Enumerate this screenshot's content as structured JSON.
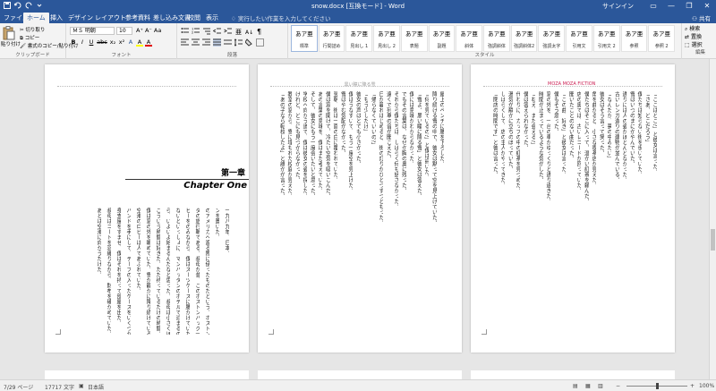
{
  "titlebar": {
    "title": "snow.docx [互換モード] - Word",
    "signin": "サインイン"
  },
  "tabs": [
    {
      "label": "ファイル"
    },
    {
      "label": "ホーム"
    },
    {
      "label": "挿入"
    },
    {
      "label": "デザイン"
    },
    {
      "label": "レイアウト"
    },
    {
      "label": "参考資料"
    },
    {
      "label": "差し込み文書"
    },
    {
      "label": "校閲"
    },
    {
      "label": "表示"
    }
  ],
  "tell_me": "実行したい作業を入力してください",
  "share": "共有",
  "ribbon": {
    "clipboard": {
      "paste": "貼り付け",
      "cut": "切り取り",
      "copy": "コピー",
      "format_painter": "書式のコピー/貼り付け",
      "group": "クリップボード"
    },
    "font": {
      "name": "ＭＳ 明朝",
      "size": "10",
      "buttons": [
        "B",
        "I",
        "U",
        "abc",
        "x₂",
        "x²",
        "A",
        "A",
        "A"
      ],
      "group": "フォント"
    },
    "paragraph": {
      "group": "段落"
    },
    "styles": {
      "group": "スタイル",
      "items": [
        {
          "sample": "あア亜",
          "name": "標準"
        },
        {
          "sample": "あア亜",
          "name": "行間詰め"
        },
        {
          "sample": "あア亜",
          "name": "見出し 1"
        },
        {
          "sample": "あア亜",
          "name": "見出し 2"
        },
        {
          "sample": "あア亜",
          "name": "表題"
        },
        {
          "sample": "あア亜",
          "name": "副題"
        },
        {
          "sample": "あア亜",
          "name": "斜体"
        },
        {
          "sample": "あア亜",
          "name": "強調斜体"
        },
        {
          "sample": "あア亜",
          "name": "強調斜体2"
        },
        {
          "sample": "あア亜",
          "name": "強調太字"
        },
        {
          "sample": "あア亜",
          "name": "引用文"
        },
        {
          "sample": "あア亜",
          "name": "引用文 2"
        },
        {
          "sample": "あア亜",
          "name": "参照"
        },
        {
          "sample": "あア亜",
          "name": "参照 2"
        }
      ]
    },
    "editing": {
      "group": "編集",
      "find": "検索",
      "replace": "置換",
      "select": "選択"
    }
  },
  "pages": {
    "p2_header": "黒い瞳に降る雪",
    "p3_header": "MOZA MOZA FICTION",
    "chapter_jp": "第一章",
    "chapter_en": "Chapter One",
    "p1_columns": [
      "一九八九年、日本。",
      "ンを置いた。",
      "のアメリカへ渡る際に使ったものだという。ボストンバッグの中にはパス",
      "ダの旅行鞄である。叔母が昔、このボストンバッグ一つで",
      "ヒーをのみながら、僕はスーツケースに腰かけていた。",
      "ないといっしょに、マンハッタンのホテルで泊まるのだ。",
      "ら、いよいよ始まるんだなと思った。叔母は小さくほほえんだ。",
      "こういう時間は好きだ。ただ待っているだけの時間。",
      "僕は窓の外を眺めていた。雪が静かに降り続けている。",
      "空港のロビーは人であふれていた。",
      "バンドを手にして、テープの入ったケースをいくつか",
      "身支度をすませ、僕はそれを持って部屋を出た。",
      "叔母はコートを羽織りながら、財布を確かめていた。",
      "あとは空港に向かうだけだ。"
    ],
    "p2_columns": [
      "屋上のベンチに腰を下ろした。",
      "降り続ける雪の中で、彼女は黙って空を見上げていた。",
      "「何を見ているの?」と僕は訊いた。",
      "「雪よ。黒い瞳に降る雪」と彼女は答えた。",
      "僕には意味がわからなかった。",
      "でもその言葉は、なぜか胸の奥に残った。",
      "それから僕たちは、しばらく何も話さなかった。",
      "遠くで列車の音が聞こえた。",
      "日が暮れはじめると、街の灯りがひとつずつともった。",
      "「帰らなくていいの?」",
      "「もう少しだけ」",
      "彼女の声はとても小さかった。",
      "僕はうなずいて、もう一度空を見上げた。",
      "雪はやむ気配がなかった。",
      "翌朝、街は一面の白に覆われていた。",
      "僕は窓を開けて、冷たい空気を吸いこんだ。",
      "あの言葉の意味を、僕はまだ考えていた。",
      "そして、彼女にもう一度会いたいと思った。",
      "学校へ向かう道で、僕は彼女の姿を探した。",
      "けれど、どこにも見つからなかった。",
      "教室の窓から、雪に埋もれた校庭が見えた。",
      "「あの子なら転校したよ」と誰かが言った。"
    ],
    "p3_columns": [
      "「ここはどこ?」と彼女は言った。",
      "「さあ、どこだろう」",
      "僕たちは知らない街を歩いていた。",
      "雪はいつのまにかやんでいた。",
      "通りには人の姿がほとんどなかった。",
      "古いレンガ造りの建物が並んでいる。",
      "「なんだか、夢の中みたい」",
      "彼女はそう言って笑った。",
      "角を曲がると、小さな喫茶店が見えた。",
      "僕たちはそこに入って、温かい紅茶を頼んだ。",
      "店の奥では、古いレコードが回っていた。",
      "聞いたことのない曲だった。",
      "「この曲、好き」と彼女は言った。",
      "僕もそう思った。",
      "窓の外を、一台の車がゆっくりと通り過ぎた。",
      "時間が止まっているような気がした。",
      "「ねえ、また会える?」",
      "僕は答えられなかった。",
      "代わりに、カップの中の紅茶を見つめた。",
      "湯気が静かに立ちのぼっていた。",
      "しばらくして、店の主人がやってきた。",
      "「閉店の時間です」と彼は言った。"
    ]
  },
  "status": {
    "page": "7/29 ページ",
    "words": "17717 文字",
    "lang": "日本語",
    "zoom": "100%",
    "zoom_level": 1.0
  }
}
